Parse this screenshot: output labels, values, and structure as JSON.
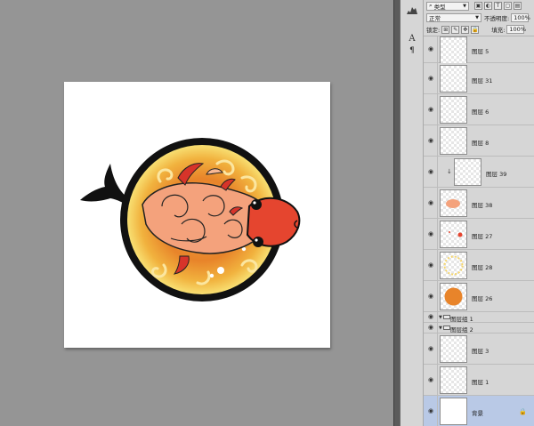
{
  "layers_panel": {
    "filter": {
      "kind_label": "类型"
    },
    "blend_mode": "正常",
    "opacity": {
      "label": "不透明度:",
      "value": "100%"
    },
    "lock": {
      "label": "锁定:"
    },
    "fill": {
      "label": "填充:",
      "value": "100%"
    },
    "layers": [
      {
        "name": "图层 5",
        "type": "layer",
        "thumb": "empty"
      },
      {
        "name": "图层 31",
        "type": "layer",
        "thumb": "empty"
      },
      {
        "name": "图层 6",
        "type": "layer",
        "thumb": "empty"
      },
      {
        "name": "图层 8",
        "type": "layer",
        "thumb": "empty"
      },
      {
        "name": "图层 39",
        "type": "layer",
        "thumb": "empty",
        "clipped": true
      },
      {
        "name": "图层 38",
        "type": "layer",
        "thumb": "salmon-blob"
      },
      {
        "name": "图层 27",
        "type": "layer",
        "thumb": "red-dots"
      },
      {
        "name": "图层 28",
        "type": "layer",
        "thumb": "yellow-ring"
      },
      {
        "name": "图层 26",
        "type": "layer",
        "thumb": "orange-circle"
      },
      {
        "name": "图层组 1",
        "type": "group"
      },
      {
        "name": "图层组 2",
        "type": "group"
      },
      {
        "name": "图层 3",
        "type": "layer",
        "thumb": "empty"
      },
      {
        "name": "图层 1",
        "type": "layer",
        "thumb": "empty"
      },
      {
        "name": "背景",
        "type": "background",
        "thumb": "white",
        "selected": true,
        "locked": true
      }
    ]
  },
  "colors": {
    "workspace": "#959595",
    "panel": "#d6d6d6",
    "selected_layer": "#b9c9e6",
    "art_orange": "#e8842a",
    "art_yellow": "#f6d66a",
    "art_salmon": "#f4a27c",
    "art_red": "#e5452f"
  }
}
